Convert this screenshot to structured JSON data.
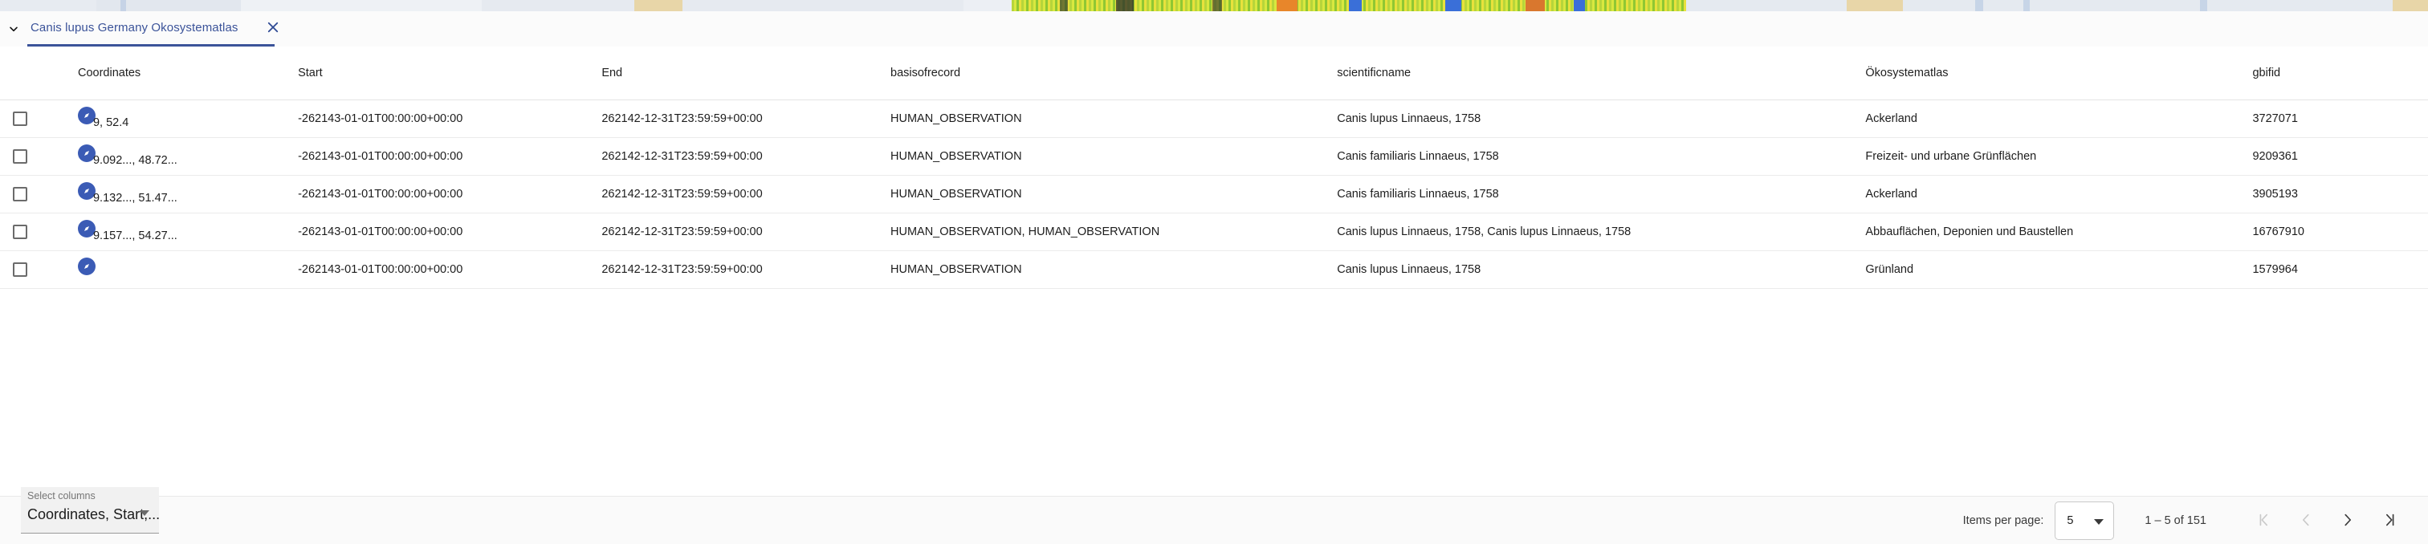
{
  "tab": {
    "toggle_icon": "chevron-down-icon",
    "label": "Canis lupus Germany Okosystematlas",
    "close_icon": "close-icon",
    "accent_color": "#3b5399"
  },
  "table": {
    "columns": [
      {
        "key": "select",
        "label": ""
      },
      {
        "key": "coordinates",
        "label": "Coordinates"
      },
      {
        "key": "start",
        "label": "Start"
      },
      {
        "key": "end",
        "label": "End"
      },
      {
        "key": "basisofrecord",
        "label": "basisofrecord"
      },
      {
        "key": "scientificname",
        "label": "scientificname"
      },
      {
        "key": "oekosystematlas",
        "label": "Ökosystematlas"
      },
      {
        "key": "gbifid",
        "label": "gbifid"
      }
    ],
    "row_icon": "compass-icon",
    "row_icon_color": "#3b5bb5",
    "rows": [
      {
        "coordinates": "9, 52.4",
        "start": "-262143-01-01T00:00:00+00:00",
        "end": "262142-12-31T23:59:59+00:00",
        "basisofrecord": "HUMAN_OBSERVATION",
        "scientificname": "Canis lupus Linnaeus, 1758",
        "oekosystematlas": "Ackerland",
        "gbifid": "3727071"
      },
      {
        "coordinates": "9.092..., 48.72...",
        "start": "-262143-01-01T00:00:00+00:00",
        "end": "262142-12-31T23:59:59+00:00",
        "basisofrecord": "HUMAN_OBSERVATION",
        "scientificname": "Canis familiaris Linnaeus, 1758",
        "oekosystematlas": "Freizeit- und urbane Grünflächen",
        "gbifid": "9209361"
      },
      {
        "coordinates": "9.132..., 51.47...",
        "start": "-262143-01-01T00:00:00+00:00",
        "end": "262142-12-31T23:59:59+00:00",
        "basisofrecord": "HUMAN_OBSERVATION",
        "scientificname": "Canis familiaris Linnaeus, 1758",
        "oekosystematlas": "Ackerland",
        "gbifid": "3905193"
      },
      {
        "coordinates": "9.157..., 54.27...",
        "start": "-262143-01-01T00:00:00+00:00",
        "end": "262142-12-31T23:59:59+00:00",
        "basisofrecord": "HUMAN_OBSERVATION, HUMAN_OBSERVATION",
        "scientificname": "Canis lupus Linnaeus, 1758, Canis lupus Linnaeus, 1758",
        "oekosystematlas": "Abbauflächen, Deponien und Baustellen",
        "gbifid": "16767910"
      },
      {
        "coordinates": "",
        "start": "-262143-01-01T00:00:00+00:00",
        "end": "262142-12-31T23:59:59+00:00",
        "basisofrecord": "HUMAN_OBSERVATION",
        "scientificname": "Canis lupus Linnaeus, 1758",
        "oekosystematlas": "Grünland",
        "gbifid": "1579964"
      }
    ]
  },
  "select_columns": {
    "label": "Select columns",
    "value": "Coordinates, Start,...",
    "arrow_icon": "dropdown-arrow-icon"
  },
  "paginator": {
    "items_per_page_label": "Items per page:",
    "items_per_page_value": "5",
    "range_label": "1 – 5 of 151",
    "first_page_icon": "first-page-icon",
    "previous_page_icon": "previous-page-icon",
    "next_page_icon": "next-page-icon",
    "last_page_icon": "last-page-icon"
  }
}
